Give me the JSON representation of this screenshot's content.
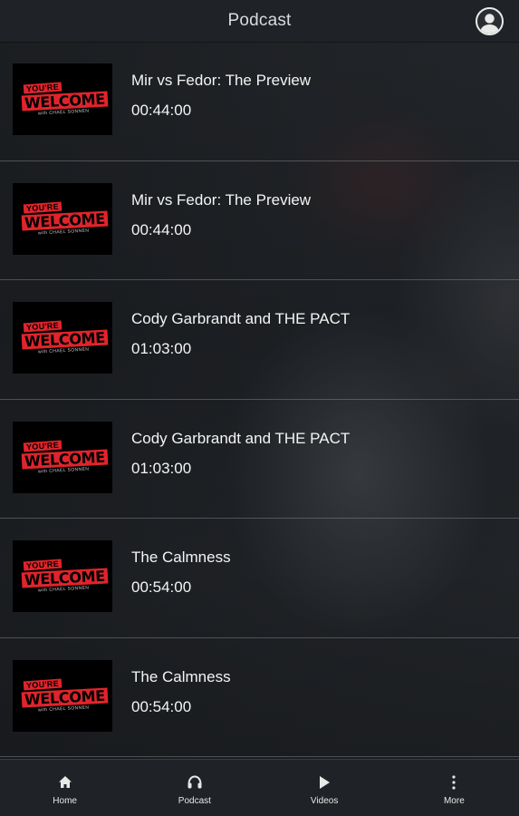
{
  "header": {
    "title": "Podcast",
    "avatar_icon": "user-circle-icon"
  },
  "thumbnail": {
    "logo_top": "YOU'RE",
    "logo_main": "WELCOME",
    "logo_sub": "with CHAEL SONNEN",
    "accent": "#e0242b"
  },
  "episodes": [
    {
      "title": "Mir vs Fedor: The Preview",
      "duration": "00:44:00"
    },
    {
      "title": "Mir vs Fedor: The Preview",
      "duration": "00:44:00"
    },
    {
      "title": "Cody Garbrandt and THE PACT",
      "duration": "01:03:00"
    },
    {
      "title": "Cody Garbrandt and THE PACT",
      "duration": "01:03:00"
    },
    {
      "title": "The Calmness",
      "duration": "00:54:00"
    },
    {
      "title": "The Calmness",
      "duration": "00:54:00"
    }
  ],
  "nav": {
    "home": {
      "label": "Home",
      "icon": "home-icon"
    },
    "podcast": {
      "label": "Podcast",
      "icon": "headphones-icon"
    },
    "videos": {
      "label": "Videos",
      "icon": "play-icon"
    },
    "more": {
      "label": "More",
      "icon": "more-vertical-icon"
    }
  }
}
